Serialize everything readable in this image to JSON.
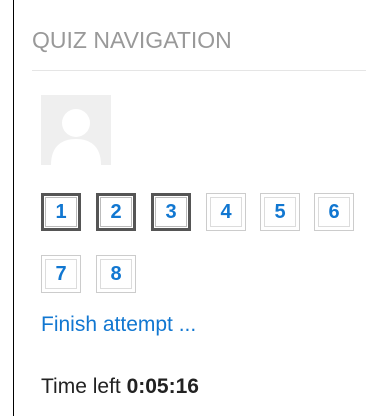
{
  "nav": {
    "title": "QUIZ NAVIGATION",
    "questions": [
      {
        "label": "1",
        "visited": true
      },
      {
        "label": "2",
        "visited": true
      },
      {
        "label": "3",
        "visited": true
      },
      {
        "label": "4",
        "visited": false
      },
      {
        "label": "5",
        "visited": false
      },
      {
        "label": "6",
        "visited": false
      },
      {
        "label": "7",
        "visited": false
      },
      {
        "label": "8",
        "visited": false
      }
    ],
    "finish_label": "Finish attempt ...",
    "time_label": "Time left",
    "time_value": "0:05:16"
  },
  "colors": {
    "link": "#1177d1",
    "title": "#999999",
    "visited_border": "#555555",
    "avatar_bg": "#efefef"
  }
}
